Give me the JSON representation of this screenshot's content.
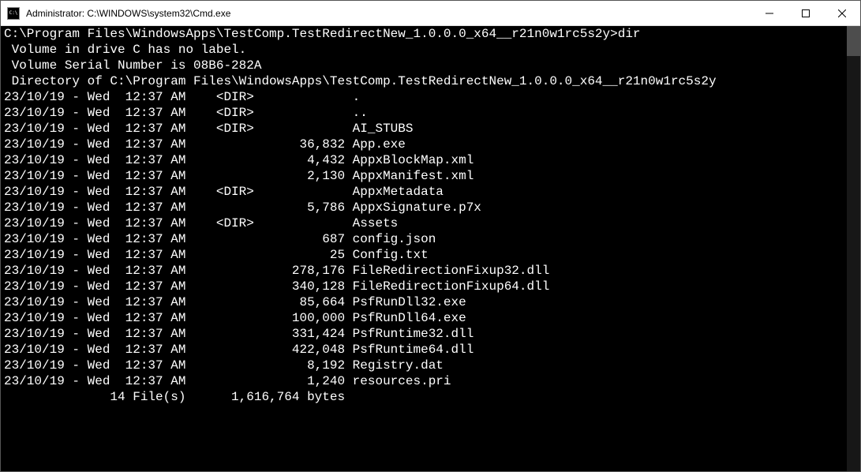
{
  "titlebar": {
    "title": "Administrator: C:\\WINDOWS\\system32\\Cmd.exe"
  },
  "terminal": {
    "prompt_path": "C:\\Program Files\\WindowsApps\\TestComp.TestRedirectNew_1.0.0.0_x64__r21n0w1rc5s2y>",
    "command": "dir",
    "volume_line": " Volume in drive C has no label.",
    "serial_line": " Volume Serial Number is 08B6-282A",
    "directory_line": " Directory of C:\\Program Files\\WindowsApps\\TestComp.TestRedirectNew_1.0.0.0_x64__r21n0w1rc5s2y",
    "entries": [
      {
        "date": "23/10/19 - Wed  12:37 AM",
        "dir": "<DIR>",
        "size": "",
        "name": "."
      },
      {
        "date": "23/10/19 - Wed  12:37 AM",
        "dir": "<DIR>",
        "size": "",
        "name": ".."
      },
      {
        "date": "23/10/19 - Wed  12:37 AM",
        "dir": "<DIR>",
        "size": "",
        "name": "AI_STUBS"
      },
      {
        "date": "23/10/19 - Wed  12:37 AM",
        "dir": "",
        "size": "36,832",
        "name": "App.exe"
      },
      {
        "date": "23/10/19 - Wed  12:37 AM",
        "dir": "",
        "size": "4,432",
        "name": "AppxBlockMap.xml"
      },
      {
        "date": "23/10/19 - Wed  12:37 AM",
        "dir": "",
        "size": "2,130",
        "name": "AppxManifest.xml"
      },
      {
        "date": "23/10/19 - Wed  12:37 AM",
        "dir": "<DIR>",
        "size": "",
        "name": "AppxMetadata"
      },
      {
        "date": "23/10/19 - Wed  12:37 AM",
        "dir": "",
        "size": "5,786",
        "name": "AppxSignature.p7x"
      },
      {
        "date": "23/10/19 - Wed  12:37 AM",
        "dir": "<DIR>",
        "size": "",
        "name": "Assets"
      },
      {
        "date": "23/10/19 - Wed  12:37 AM",
        "dir": "",
        "size": "687",
        "name": "config.json"
      },
      {
        "date": "23/10/19 - Wed  12:37 AM",
        "dir": "",
        "size": "25",
        "name": "Config.txt"
      },
      {
        "date": "23/10/19 - Wed  12:37 AM",
        "dir": "",
        "size": "278,176",
        "name": "FileRedirectionFixup32.dll"
      },
      {
        "date": "23/10/19 - Wed  12:37 AM",
        "dir": "",
        "size": "340,128",
        "name": "FileRedirectionFixup64.dll"
      },
      {
        "date": "23/10/19 - Wed  12:37 AM",
        "dir": "",
        "size": "85,664",
        "name": "PsfRunDll32.exe"
      },
      {
        "date": "23/10/19 - Wed  12:37 AM",
        "dir": "",
        "size": "100,000",
        "name": "PsfRunDll64.exe"
      },
      {
        "date": "23/10/19 - Wed  12:37 AM",
        "dir": "",
        "size": "331,424",
        "name": "PsfRuntime32.dll"
      },
      {
        "date": "23/10/19 - Wed  12:37 AM",
        "dir": "",
        "size": "422,048",
        "name": "PsfRuntime64.dll"
      },
      {
        "date": "23/10/19 - Wed  12:37 AM",
        "dir": "",
        "size": "8,192",
        "name": "Registry.dat"
      },
      {
        "date": "23/10/19 - Wed  12:37 AM",
        "dir": "",
        "size": "1,240",
        "name": "resources.pri"
      }
    ],
    "summary_files": "              14 File(s)      1,616,764 bytes"
  }
}
